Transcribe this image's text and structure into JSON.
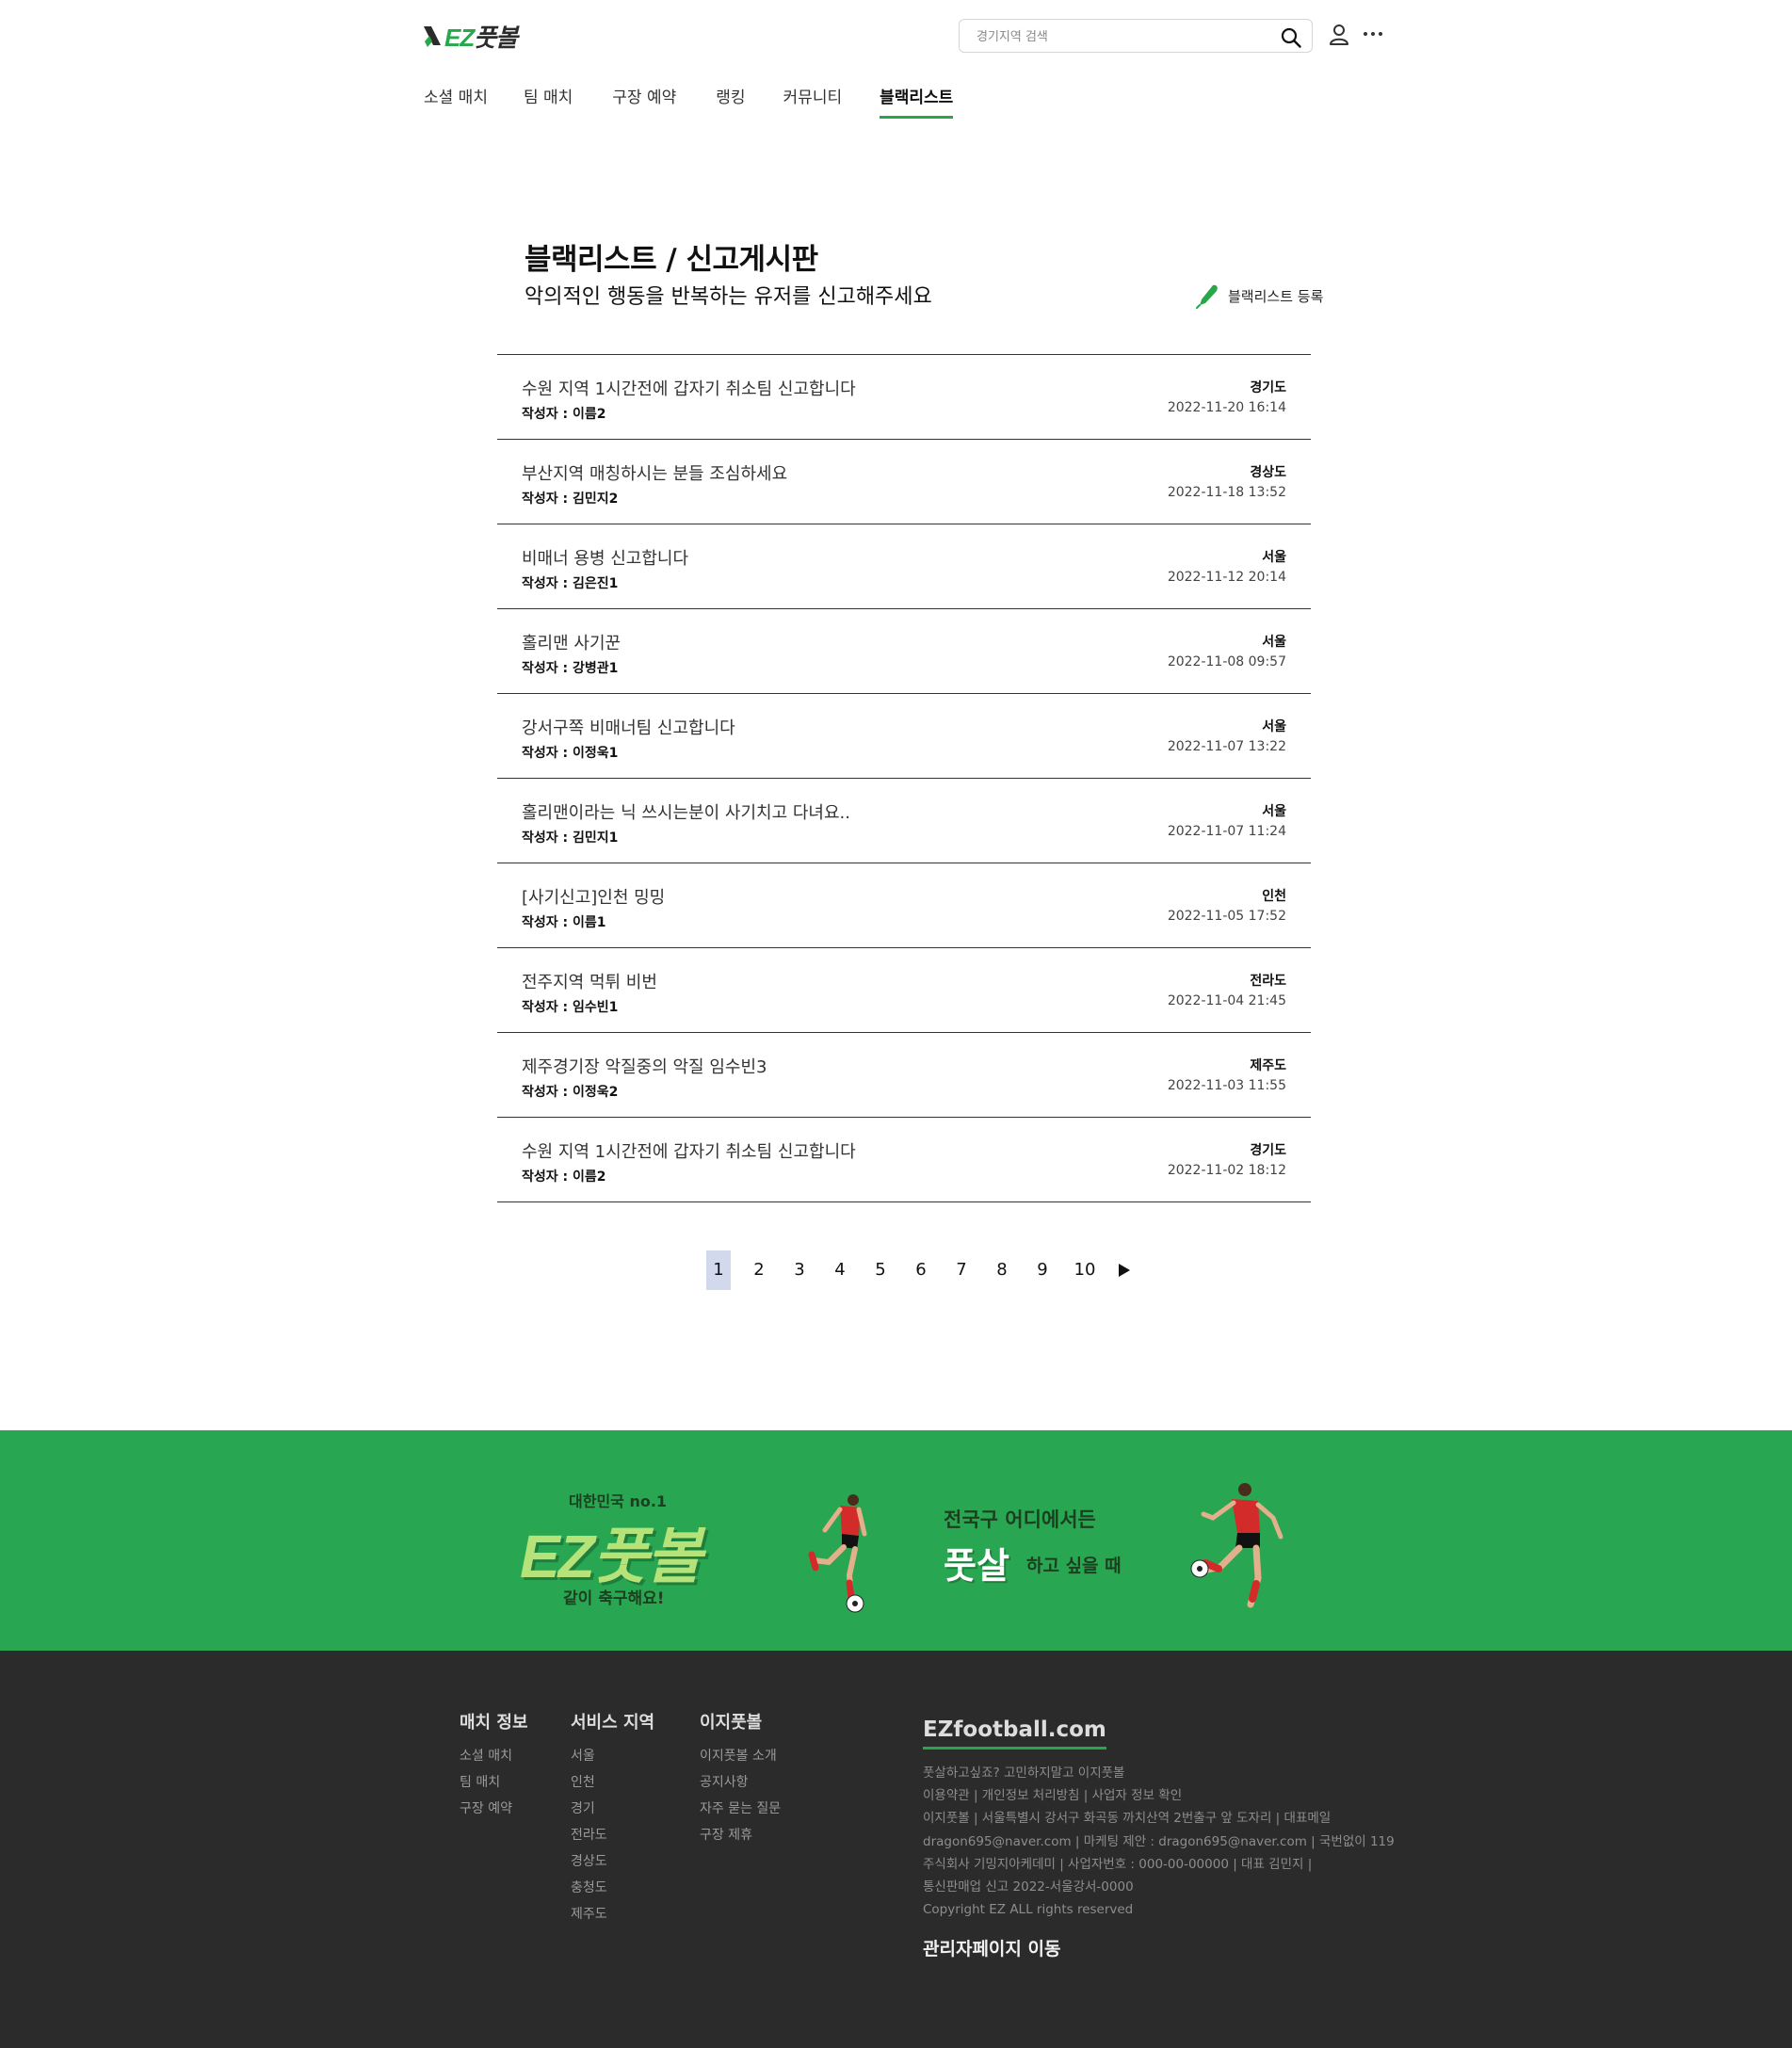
{
  "header": {
    "logo_text": "EZ풋볼",
    "search_placeholder": "경기지역 검색"
  },
  "nav": [
    {
      "label": "소셜 매치"
    },
    {
      "label": "팀 매치"
    },
    {
      "label": "구장 예약"
    },
    {
      "label": "랭킹"
    },
    {
      "label": "커뮤니티"
    },
    {
      "label": "블랙리스트",
      "active": true
    }
  ],
  "main": {
    "title": "블랙리스트 / 신고게시판",
    "subtitle": "악의적인 행동을 반복하는 유저를 신고해주세요",
    "register_label": "블랙리스트 등록",
    "accent_color": "#27a74a"
  },
  "posts": [
    {
      "title": "수원 지역 1시간전에 갑자기 취소팀 신고합니다",
      "author": "작성자 : 이름2",
      "region": "경기도",
      "date": "2022-11-20 16:14"
    },
    {
      "title": "부산지역 매칭하시는 분들 조심하세요",
      "author": "작성자 : 김민지2",
      "region": "경상도",
      "date": "2022-11-18 13:52"
    },
    {
      "title": "비매너 용병 신고합니다",
      "author": "작성자 : 김은진1",
      "region": "서울",
      "date": "2022-11-12 20:14"
    },
    {
      "title": "홀리맨 사기꾼",
      "author": "작성자 : 강병관1",
      "region": "서울",
      "date": "2022-11-08 09:57"
    },
    {
      "title": "강서구쪽 비매너팀 신고합니다",
      "author": "작성자 : 이정욱1",
      "region": "서울",
      "date": "2022-11-07 13:22"
    },
    {
      "title": "홀리맨이라는 닉 쓰시는분이 사기치고 다녀요..",
      "author": "작성자 : 김민지1",
      "region": "서울",
      "date": "2022-11-07 11:24"
    },
    {
      "title": "[사기신고]인천 밍밍",
      "author": "작성자 : 이름1",
      "region": "인천",
      "date": "2022-11-05 17:52"
    },
    {
      "title": "전주지역 먹튀 비번",
      "author": "작성자 : 임수빈1",
      "region": "전라도",
      "date": "2022-11-04 21:45"
    },
    {
      "title": "제주경기장 악질중의 악질 임수빈3",
      "author": "작성자 : 이정욱2",
      "region": "제주도",
      "date": "2022-11-03 11:55"
    },
    {
      "title": "수원 지역 1시간전에 갑자기 취소팀 신고합니다",
      "author": "작성자 : 이름2",
      "region": "경기도",
      "date": "2022-11-02 18:12"
    }
  ],
  "pagination": {
    "pages": [
      "1",
      "2",
      "3",
      "4",
      "5",
      "6",
      "7",
      "8",
      "9",
      "10"
    ],
    "current": "1",
    "next_icon": "play-triangle-icon"
  },
  "banner": {
    "tagline": "대한민국 no.1",
    "logo": "EZ풋볼",
    "slogan": "같이 축구해요!",
    "where": "전국구 어디에서든",
    "futsal": "풋살",
    "want": "하고 싶을 때",
    "bg_color": "#29a652"
  },
  "footer": {
    "columns": [
      {
        "heading": "매치 정보",
        "links": [
          "소셜 매치",
          "팀 매치",
          "구장 예약"
        ]
      },
      {
        "heading": "서비스 지역",
        "links": [
          "서울",
          "인천",
          "경기",
          "전라도",
          "경상도",
          "충청도",
          "제주도"
        ]
      },
      {
        "heading": "이지풋볼",
        "links": [
          "이지풋볼 소개",
          "공지사항",
          "자주 묻는 질문",
          "구장 제휴"
        ]
      }
    ],
    "site": "EZfootball.com",
    "info_lines": [
      "풋살하고싶죠? 고민하지말고 이지풋볼",
      "이용약관 | 개인정보 처리방침 | 사업자 정보 확인",
      "이지풋볼 | 서울특별시 강서구 화곡동 까치산역 2번출구 앞 도자리 | 대표메일",
      "dragon695@naver.com | 마케팅 제안 : dragon695@naver.com | 국번없이 119",
      "주식회사 기밍지아케데미 | 사업자번호 : 000-00-00000 | 대표 김민지 |",
      "통신판매업 신고 2022-서울강서-0000",
      "Copyright EZ ALL rights reserved"
    ],
    "admin_link": "관리자페이지 이동",
    "bg_color": "#2b2b2b"
  }
}
